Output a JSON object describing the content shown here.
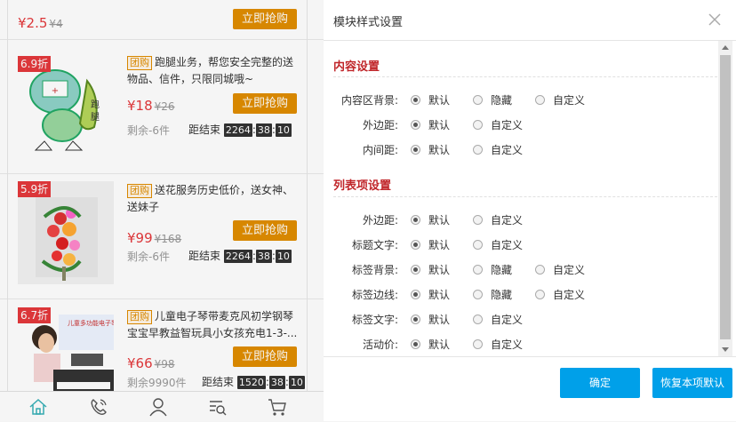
{
  "preview": {
    "top_item": {
      "price": "¥2.5",
      "old_price": "¥4",
      "buy_label": "立即抢购"
    },
    "items": [
      {
        "discount": "6.9折",
        "tag": "团购",
        "title": "跑腿业务，帮您安全完整的送物品、信件，只限同城哦~",
        "price": "¥18",
        "old_price": "¥26",
        "buy_label": "立即抢购",
        "remain": "剩余-6件",
        "countdown_label": "距结束",
        "t1": "2264",
        "t2": "38",
        "t3": "10"
      },
      {
        "discount": "5.9折",
        "tag": "团购",
        "title": "送花服务历史低价，送女神、送妹子",
        "price": "¥99",
        "old_price": "¥168",
        "buy_label": "立即抢购",
        "remain": "剩余-6件",
        "countdown_label": "距结束",
        "t1": "2264",
        "t2": "38",
        "t3": "10"
      },
      {
        "discount": "6.7折",
        "tag": "团购",
        "title": "儿童电子琴带麦克风初学钢琴宝宝早教益智玩具小女孩充电1-3-...",
        "price": "¥66",
        "old_price": "¥98",
        "buy_label": "立即抢购",
        "remain": "剩余9990件",
        "countdown_label": "距结束",
        "t1": "1520",
        "t2": "38",
        "t3": "10"
      }
    ],
    "accent_color": "#e08d00",
    "price_color": "#e4393c"
  },
  "dialog": {
    "title": "模块样式设置",
    "sections": [
      {
        "title": "内容设置",
        "rows": [
          {
            "label": "内容区背景:",
            "options": [
              "默认",
              "隐藏",
              "自定义"
            ],
            "selected": 0
          },
          {
            "label": "外边距:",
            "options": [
              "默认",
              "自定义"
            ],
            "selected": 0
          },
          {
            "label": "内间距:",
            "options": [
              "默认",
              "自定义"
            ],
            "selected": 0
          }
        ]
      },
      {
        "title": "列表项设置",
        "rows": [
          {
            "label": "外边距:",
            "options": [
              "默认",
              "自定义"
            ],
            "selected": 0
          },
          {
            "label": "标题文字:",
            "options": [
              "默认",
              "自定义"
            ],
            "selected": 0
          },
          {
            "label": "标签背景:",
            "options": [
              "默认",
              "隐藏",
              "自定义"
            ],
            "selected": 0
          },
          {
            "label": "标签边线:",
            "options": [
              "默认",
              "隐藏",
              "自定义"
            ],
            "selected": 0
          },
          {
            "label": "标签文字:",
            "options": [
              "默认",
              "自定义"
            ],
            "selected": 0
          },
          {
            "label": "活动价:",
            "options": [
              "默认",
              "自定义"
            ],
            "selected": 0
          }
        ]
      }
    ],
    "confirm_label": "确定",
    "reset_label": "恢复本项默认",
    "section_color": "#c0262a",
    "button_color": "#00a0e9"
  }
}
